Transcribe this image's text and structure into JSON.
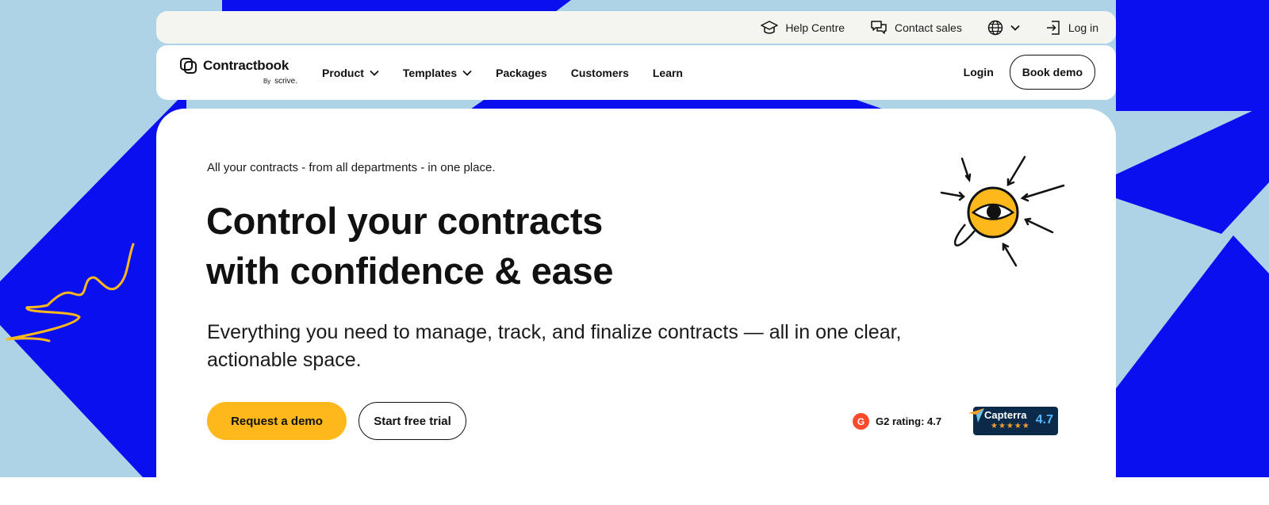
{
  "utility_bar": {
    "help_centre": "Help Centre",
    "contact_sales": "Contact sales",
    "log_in": "Log in"
  },
  "nav": {
    "logo": {
      "name": "Contractbook",
      "by": "By",
      "brand": "scrive."
    },
    "items": [
      {
        "label": "Product",
        "has_dropdown": true
      },
      {
        "label": "Templates",
        "has_dropdown": true
      },
      {
        "label": "Packages",
        "has_dropdown": false
      },
      {
        "label": "Customers",
        "has_dropdown": false
      },
      {
        "label": "Learn",
        "has_dropdown": false
      }
    ],
    "login": "Login",
    "book_demo": "Book demo"
  },
  "hero": {
    "eyebrow": "All your contracts - from all departments - in one place.",
    "headline_line1": "Control your contracts",
    "headline_line2": "with confidence & ease",
    "subheadline": "Everything you need to manage, track, and finalize contracts — all in one clear, actionable space.",
    "cta_primary": "Request a demo",
    "cta_secondary": "Start free trial",
    "g2_rating": "G2 rating: 4.7",
    "capterra": {
      "name": "Capterra",
      "score": "4.7",
      "stars": "★★★★★"
    }
  },
  "colors": {
    "background_blue": "#0a0ff0",
    "background_light_blue": "#aed3e6",
    "primary_cta": "#ffb81c",
    "squiggle": "#ffb81c",
    "capterra_bg": "#0b2a4a"
  }
}
